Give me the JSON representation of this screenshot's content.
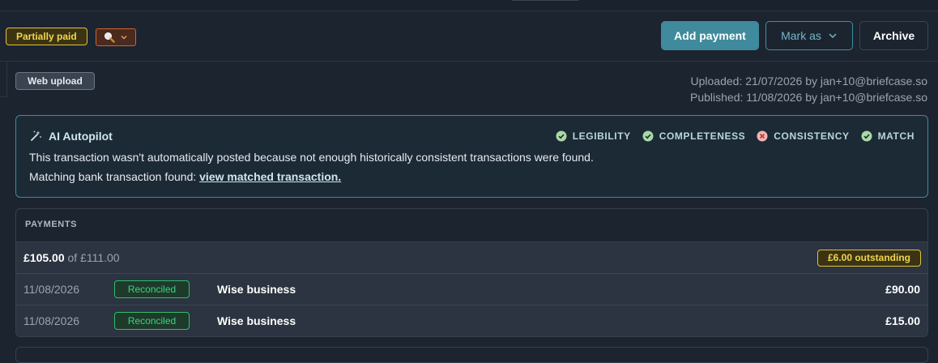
{
  "toolbar": {
    "status_badge": "Partially paid",
    "add_payment": "Add payment",
    "mark_as": "Mark as",
    "archive": "Archive"
  },
  "source": {
    "badge": "Web upload",
    "uploaded": "Uploaded: 21/07/2026 by jan+10@briefcase.so",
    "published": "Published: 11/08/2026 by jan+10@briefcase.so"
  },
  "autopilot": {
    "title": "AI Autopilot",
    "checks": [
      {
        "label": "LEGIBILITY",
        "state": "pass"
      },
      {
        "label": "COMPLETENESS",
        "state": "pass"
      },
      {
        "label": "CONSISTENCY",
        "state": "fail"
      },
      {
        "label": "MATCH",
        "state": "pass"
      }
    ],
    "message": "This transaction wasn't automatically posted because not enough historically consistent transactions were found.",
    "match_prefix": "Matching bank transaction found: ",
    "match_link": "view matched transaction."
  },
  "payments": {
    "header": "PAYMENTS",
    "paid": "£105.00",
    "of_total": "of £111.00",
    "outstanding": "£6.00 outstanding",
    "rows": [
      {
        "date": "11/08/2026",
        "status": "Reconciled",
        "description": "Wise business",
        "amount": "£90.00"
      },
      {
        "date": "11/08/2026",
        "status": "Reconciled",
        "description": "Wise business",
        "amount": "£15.00"
      }
    ]
  },
  "colors": {
    "background": "#1c2430",
    "accent": "#3f8a9c",
    "warning": "#f3d54a",
    "success": "#3ed47a",
    "danger": "#e05a5a"
  }
}
